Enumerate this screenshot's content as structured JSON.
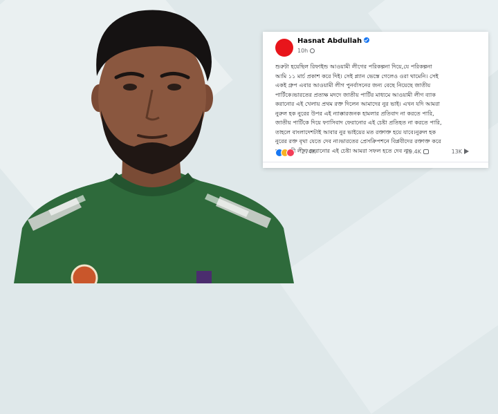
{
  "post": {
    "author": "Hasnat Abdullah",
    "time": "10h",
    "lines": [
      "শুরুটা হয়েছিল রিফাইন্ড আওয়ামী লীগের পরিকল্পনা দিয়ে,যে পরিকল্পনা",
      "আমি ১১ মার্চ প্রকাশ করে দিই। সেই প্ল্যান ভেস্তে গেলেও ওরা থামেনি। সেই",
      "একই গ্রুপ এবার আওয়ামী লীগ পুনর্বাসনের জন্য বেছে নিয়েছে জাতীয়",
      "পার্টিকে।ভারতের প্রত্যক্ষ মদদে জাতীয় পার্টির মাধ্যমে আওয়ামী লীগ ব্যাক",
      "করানোর এই খেলায় প্রথম রক্ত দিলেন আমাদের নুর ভাই। এখন যদি আমরা",
      "নুরুল হক নুরের উপর এই ন্যাক্কারজনক হামলার প্রতিবাদ না করতে পারি,",
      "জাতীয় পার্টিকে দিয়ে ফ্যাসিবাদ ফেরানোর এই চেষ্টা প্রতিহত না করতে পারি,",
      "তাহলে বাংলাদেশটাই আবার নুর ভাইয়ের মত রক্তাক্ত হয়ে যাবে।নুরুল হক",
      "নুরের রক্ত বৃথা যেতে দেব না।ভারতের প্রেসক্রিপশনে বিপ্লবীদের রক্তাক্ত করে",
      "আওয়ামী লীগ ফেরানোর এই চেষ্টা আমরা সফল হতে দেব না।"
    ],
    "reactions": "274K",
    "comments": "29.4K",
    "shares": "13K"
  },
  "icons": {
    "verified": "verified-badge-icon",
    "audience": "globe-icon",
    "reactions": [
      "like-icon",
      "wow-icon",
      "love-icon"
    ],
    "comment": "comment-icon",
    "share": "share-icon"
  },
  "colors": {
    "brand_blue": "#1877f2",
    "avatar_red": "#e8151b",
    "jersey_green": "#2f6b3c",
    "background": "#dfe8ea"
  }
}
